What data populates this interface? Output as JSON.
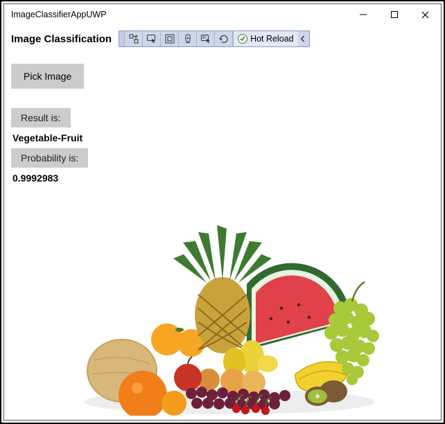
{
  "window": {
    "title": "ImageClassifierAppUWP"
  },
  "header": {
    "heading": "Image Classification",
    "hot_reload_label": "Hot Reload"
  },
  "controls": {
    "pick_image_label": "Pick Image",
    "result_label": "Result is:",
    "result_value": "Vegetable-Fruit",
    "probability_label": "Probability is:",
    "probability_value": "0.9992983"
  }
}
